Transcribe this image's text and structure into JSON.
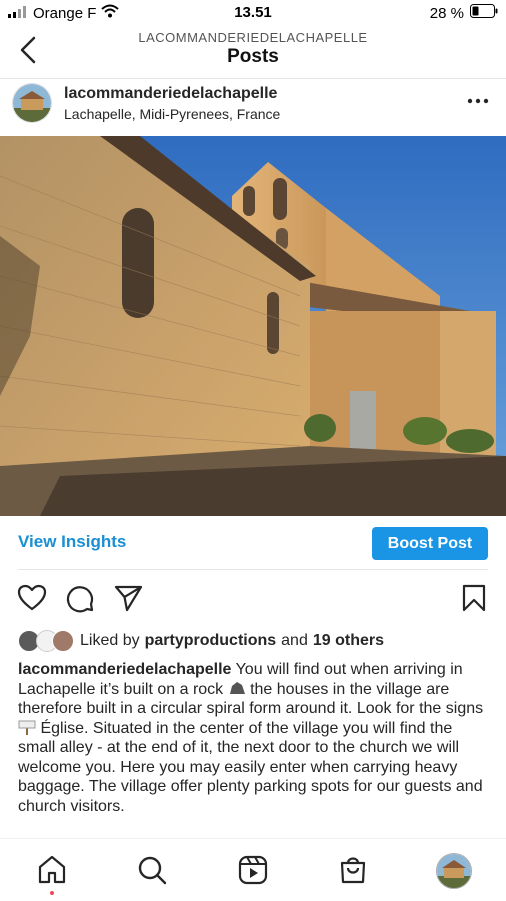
{
  "status_bar": {
    "carrier": "Orange F",
    "time": "13.51",
    "battery": "28 %"
  },
  "header": {
    "account_name": "LACOMMANDERIEDELACHAPELLE",
    "title": "Posts"
  },
  "post": {
    "username": "lacommanderiedelachapelle",
    "location": "Lachapelle, Midi-Pyrenees, France",
    "photo_icon": "church-photo",
    "view_insights": "View Insights",
    "boost_button": "Boost Post",
    "likes": {
      "prefix": "Liked by",
      "liker": "partyproductions",
      "joiner": "and",
      "others": "19 others"
    },
    "caption": {
      "username": "lacommanderiedelachapelle",
      "text_part1": "You will find out when arriving in Lachapelle it’s built on a rock",
      "text_part2": "the houses in the village are therefore built in a circular spiral form around it. Look for the signs",
      "text_part3": "Église. Situated in the center of the village you will find the small alley - at the end of it, the next door to the church we will welcome you. Here you may easily enter when carrying heavy baggage. The village offer plenty parking spots for our guests and church visitors."
    }
  },
  "colors": {
    "link_blue": "#1a8fd1",
    "boost_blue": "#1a95e6",
    "notification_red": "#ed4956"
  },
  "icons": [
    "signal-icon",
    "wifi-icon",
    "battery-icon",
    "back-icon",
    "more-icon",
    "heart-icon",
    "comment-icon",
    "share-icon",
    "bookmark-icon",
    "home-icon",
    "search-icon",
    "reels-icon",
    "shop-icon",
    "profile-avatar"
  ]
}
